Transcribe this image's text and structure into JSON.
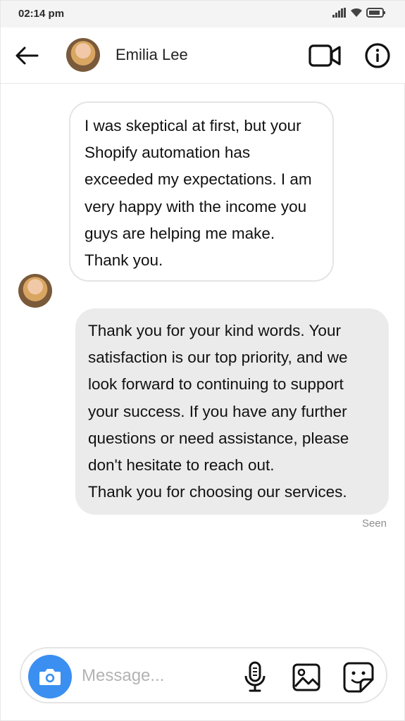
{
  "status_bar": {
    "time": "02:14 pm"
  },
  "header": {
    "contact_name": "Emilia Lee"
  },
  "messages": [
    {
      "sender": "contact",
      "text": "I was skeptical at first, but your Shopify automation has exceeded my expectations. I am very happy with the income you guys are helping me make. Thank you."
    },
    {
      "sender": "me",
      "text": "Thank you for your kind words. Your satisfaction is our top priority, and we look forward to continuing to support your success. If you have any further questions or need assistance, please don't hesitate to reach out.\nThank you for choosing our services."
    }
  ],
  "seen_label": "Seen",
  "composer": {
    "placeholder": "Message..."
  },
  "colors": {
    "accent": "#3b8ff0",
    "outgoing_bubble": "#ebebec",
    "status_bar": "#f4f4f4"
  }
}
